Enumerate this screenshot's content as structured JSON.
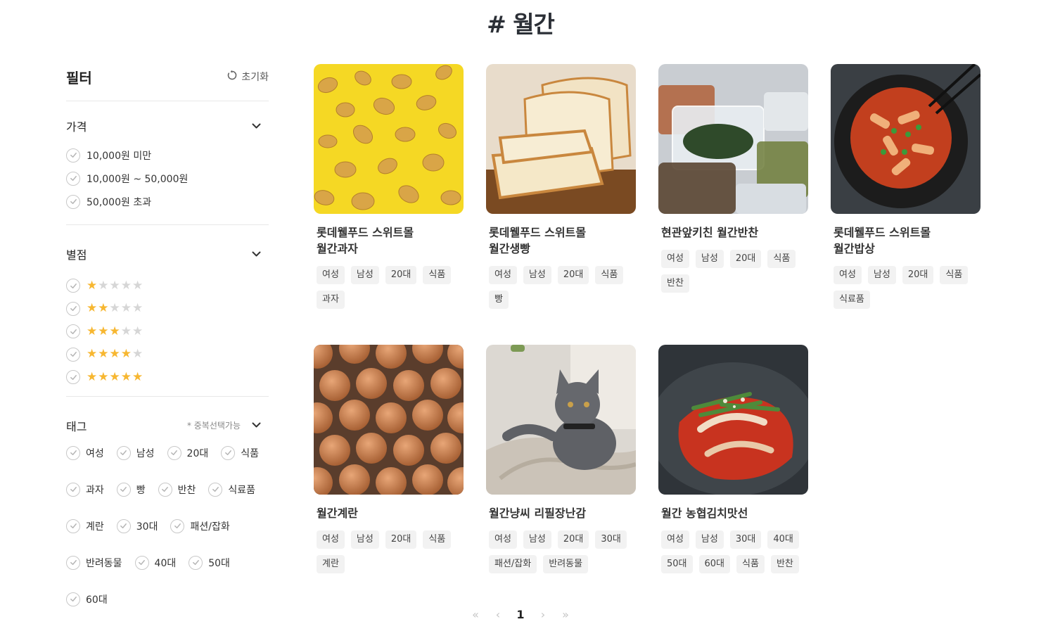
{
  "page": {
    "title": "# 월간"
  },
  "filter": {
    "title": "필터",
    "reset_label": "초기화",
    "price": {
      "title": "가격",
      "options": [
        "10,000원 미만",
        "10,000원 ~ 50,000원",
        "50,000원 초과"
      ]
    },
    "rating": {
      "title": "별점",
      "options": [
        1,
        2,
        3,
        4,
        5
      ],
      "star_color": "#f7b731"
    },
    "tags": {
      "title": "태그",
      "note": "* 중복선택가능",
      "options": [
        "여성",
        "남성",
        "20대",
        "식품",
        "과자",
        "빵",
        "반찬",
        "식료품",
        "계란",
        "30대",
        "패션/잡화",
        "반려동물",
        "40대",
        "50대",
        "60대"
      ]
    }
  },
  "products": [
    {
      "name": "롯데웰푸드 스위트몰\n월간과자",
      "tags": [
        "여성",
        "남성",
        "20대",
        "식품",
        "과자"
      ],
      "image": "potato-chips"
    },
    {
      "name": "롯데웰푸드 스위트몰\n월간생빵",
      "tags": [
        "여성",
        "남성",
        "20대",
        "식품",
        "빵"
      ],
      "image": "bread-loaf"
    },
    {
      "name": "현관앞키친 월간반찬",
      "tags": [
        "여성",
        "남성",
        "20대",
        "식품",
        "반찬"
      ],
      "image": "side-dish-containers"
    },
    {
      "name": "롯데웰푸드 스위트몰\n월간밥상",
      "tags": [
        "여성",
        "남성",
        "20대",
        "식품",
        "식료품"
      ],
      "image": "tteokbokki-bowl"
    },
    {
      "name": "월간계란",
      "tags": [
        "여성",
        "남성",
        "20대",
        "식품",
        "계란"
      ],
      "image": "eggs-tray"
    },
    {
      "name": "월간냥씨 리필장난감",
      "tags": [
        "여성",
        "남성",
        "20대",
        "30대",
        "패션/잡화",
        "반려동물"
      ],
      "image": "grey-cat"
    },
    {
      "name": "월간 농협김치맛선",
      "tags": [
        "여성",
        "남성",
        "30대",
        "40대",
        "50대",
        "60대",
        "식품",
        "반찬"
      ],
      "image": "kimchi"
    }
  ],
  "pagination": {
    "first": "«",
    "prev": "‹",
    "current": "1",
    "next": "›",
    "last": "»"
  }
}
